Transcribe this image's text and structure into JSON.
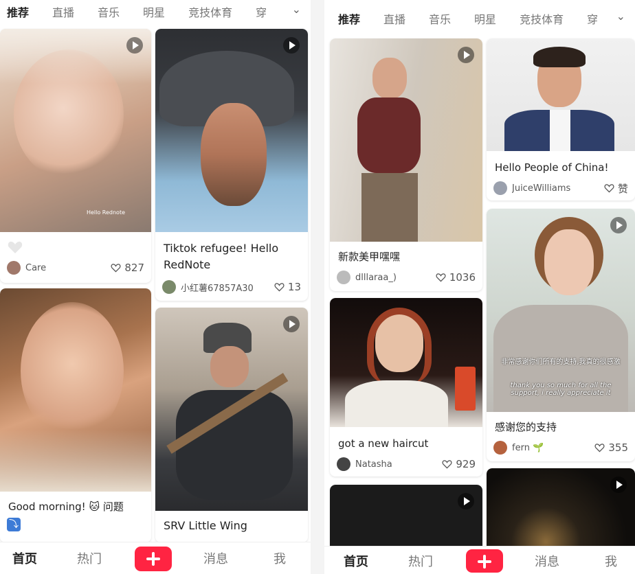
{
  "left": {
    "tabs": [
      "推荐",
      "直播",
      "音乐",
      "明星",
      "竞技体育",
      "穿"
    ],
    "cards": [
      {
        "caption": "",
        "author": "Care",
        "likes": "827"
      },
      {
        "caption": "Tiktok refugee! Hello RedNote",
        "author": "小红薯67857A30",
        "likes": "13"
      },
      {
        "caption": "Good morning! 🐱 问题",
        "author": "",
        "likes": ""
      },
      {
        "caption": "SRV Little Wing",
        "author": "",
        "likes": ""
      }
    ],
    "overlay_text": "Hello Rednote",
    "nav": {
      "home": "首页",
      "hot": "热门",
      "messages": "消息",
      "me": "我"
    }
  },
  "right": {
    "tabs": [
      "推荐",
      "直播",
      "音乐",
      "明星",
      "竞技体育",
      "穿"
    ],
    "cards": [
      {
        "caption": "新款美甲嘿嘿",
        "author": "dlllaraa_)",
        "likes": "1036"
      },
      {
        "caption": "Hello People of China!",
        "author": "JuiceWilliams",
        "likes": "赞"
      },
      {
        "caption": "got a new haircut",
        "author": "Natasha",
        "likes": "929"
      },
      {
        "caption": "感谢您的支持",
        "author": "fern 🌱",
        "likes": "355"
      },
      {
        "caption": "",
        "author": "",
        "likes": ""
      }
    ],
    "subtitle_cn": "非常感谢你们所有的支持,我真的很感激",
    "subtitle_en": "thank you so much for all the support, i really appreciate it",
    "nav": {
      "home": "首页",
      "hot": "热门",
      "messages": "消息",
      "me": "我"
    }
  },
  "colors": {
    "accent": "#ff2442",
    "text": "#222222",
    "muted": "#777777"
  },
  "icons": [
    "play-icon",
    "heart-icon",
    "plus-icon",
    "chevron-down-icon"
  ]
}
